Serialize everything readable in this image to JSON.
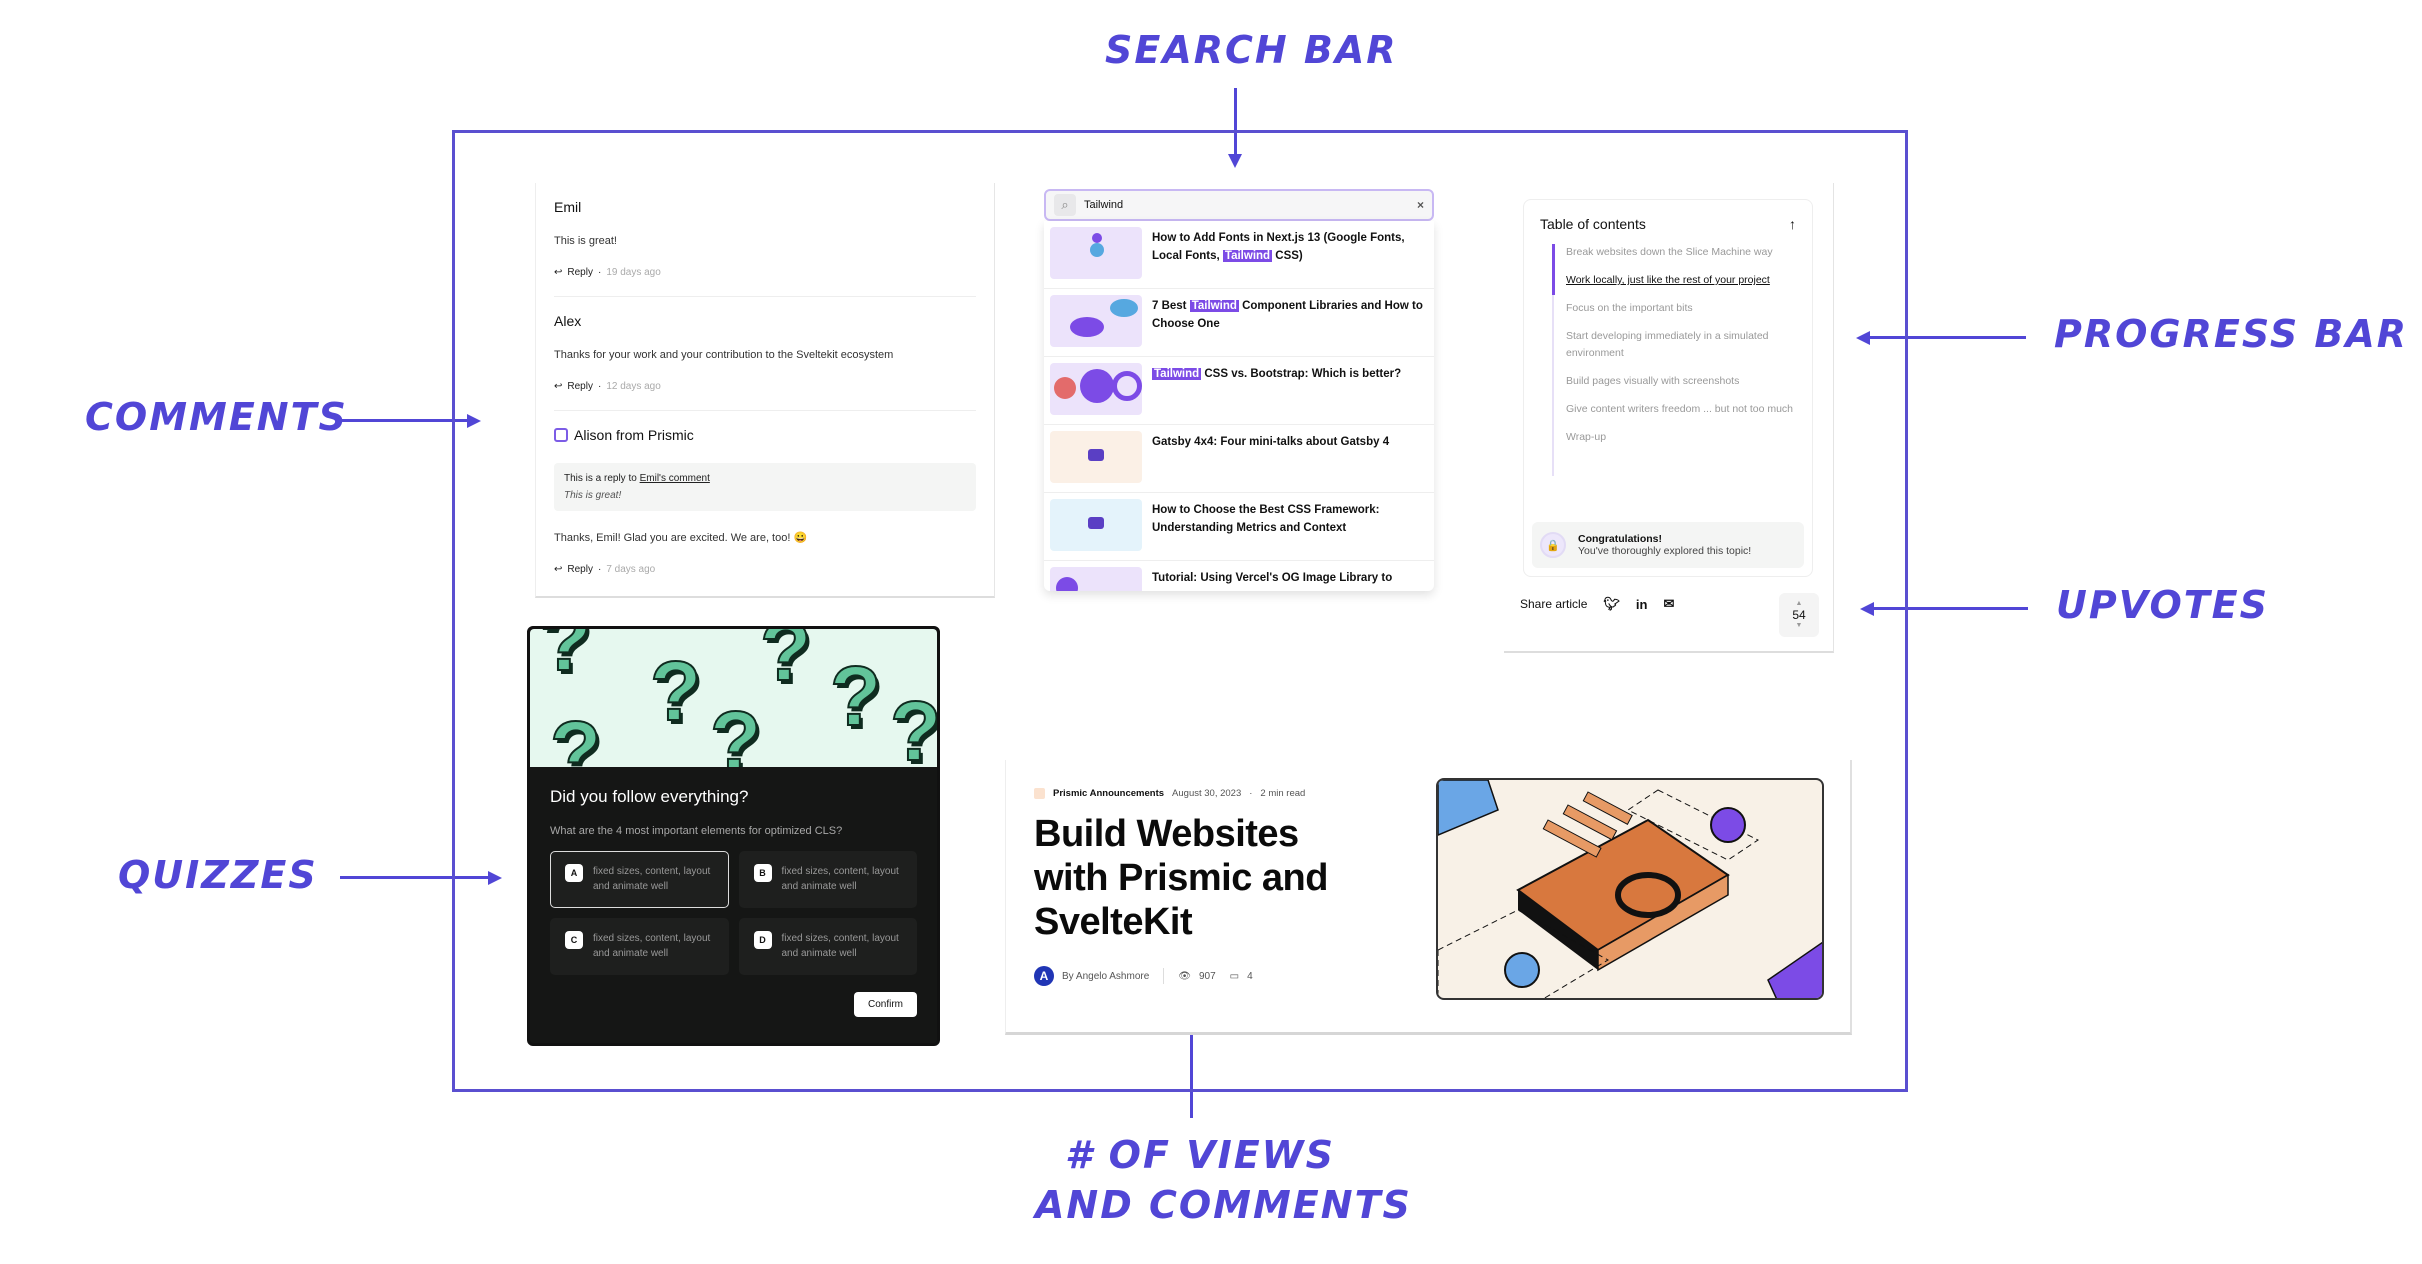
{
  "annotations": {
    "search_bar": "SEARCH BAR",
    "comments": "COMMENTS",
    "progress_bar": "PROGRESS BAR",
    "upvotes": "UPVOTES",
    "quizzes": "QUIZZES",
    "views_comments_line1": "# OF VIEWS",
    "views_comments_line2": "AND COMMENTS"
  },
  "accent_color": "#5146d6",
  "comments": [
    {
      "author": "Emil",
      "text": "This is great!",
      "reply_label": "Reply",
      "ago": "19 days ago"
    },
    {
      "author": "Alex",
      "text": "Thanks for your work and your contribution to the Sveltekit ecosystem",
      "reply_label": "Reply",
      "ago": "12 days ago"
    },
    {
      "author": "Alison from Prismic",
      "reply_to_prefix": "This is a reply to",
      "reply_to_link": "Emil's comment",
      "quoted": "This is great!",
      "text": "Thanks, Emil! Glad you are excited. We are, too! 😀",
      "reply_label": "Reply",
      "ago": "7 days ago"
    }
  ],
  "search": {
    "query": "Tailwind",
    "results": [
      {
        "pre": "How to Add Fonts in Next.js 13 (Google Fonts, Local Fonts, ",
        "highlight": "Tailwind",
        "post": " CSS)"
      },
      {
        "pre": "7 Best ",
        "highlight": "Tailwind",
        "post": " Component Libraries and How to Choose One"
      },
      {
        "pre": "",
        "highlight": "Tailwind",
        "post": " CSS vs. Bootstrap: Which is better?"
      },
      {
        "pre": "Gatsby 4x4: Four mini-talks about Gatsby 4",
        "highlight": "",
        "post": ""
      },
      {
        "pre": "How to Choose the Best CSS Framework: Understanding Metrics and Context",
        "highlight": "",
        "post": ""
      },
      {
        "pre": "Tutorial: Using Vercel's OG Image Library to",
        "highlight": "",
        "post": ""
      }
    ]
  },
  "toc": {
    "title": "Table of contents",
    "items": [
      "Break websites down the Slice Machine way",
      "Work locally, just like the rest of your project",
      "Focus on the important bits",
      "Start developing immediately in a simulated environment",
      "Build pages visually with screenshots",
      "Give content writers freedom ... but not too much",
      "Wrap-up"
    ],
    "active_index": 1,
    "progress_fraction": 0.22,
    "congrats_title": "Congratulations!",
    "congrats_text": "You've thoroughly explored this topic!",
    "share_label": "Share article",
    "upvotes": "54"
  },
  "quiz": {
    "title": "Did you follow everything?",
    "question": "What are the 4 most important elements for optimized CLS?",
    "options": [
      {
        "letter": "A",
        "text": "fixed sizes, content, layout and animate well",
        "selected": true
      },
      {
        "letter": "B",
        "text": "fixed sizes, content, layout and animate well",
        "selected": false
      },
      {
        "letter": "C",
        "text": "fixed sizes, content, layout and animate well",
        "selected": false
      },
      {
        "letter": "D",
        "text": "fixed sizes, content, layout and animate well",
        "selected": false
      }
    ],
    "confirm_label": "Confirm"
  },
  "article": {
    "category": "Prismic Announcements",
    "date": "August 30, 2023",
    "read_time": "2 min read",
    "title": "Build Websites with Prismic and SvelteKit",
    "author": "By Angelo Ashmore",
    "avatar_letter": "A",
    "views": "907",
    "comments_count": "4"
  }
}
